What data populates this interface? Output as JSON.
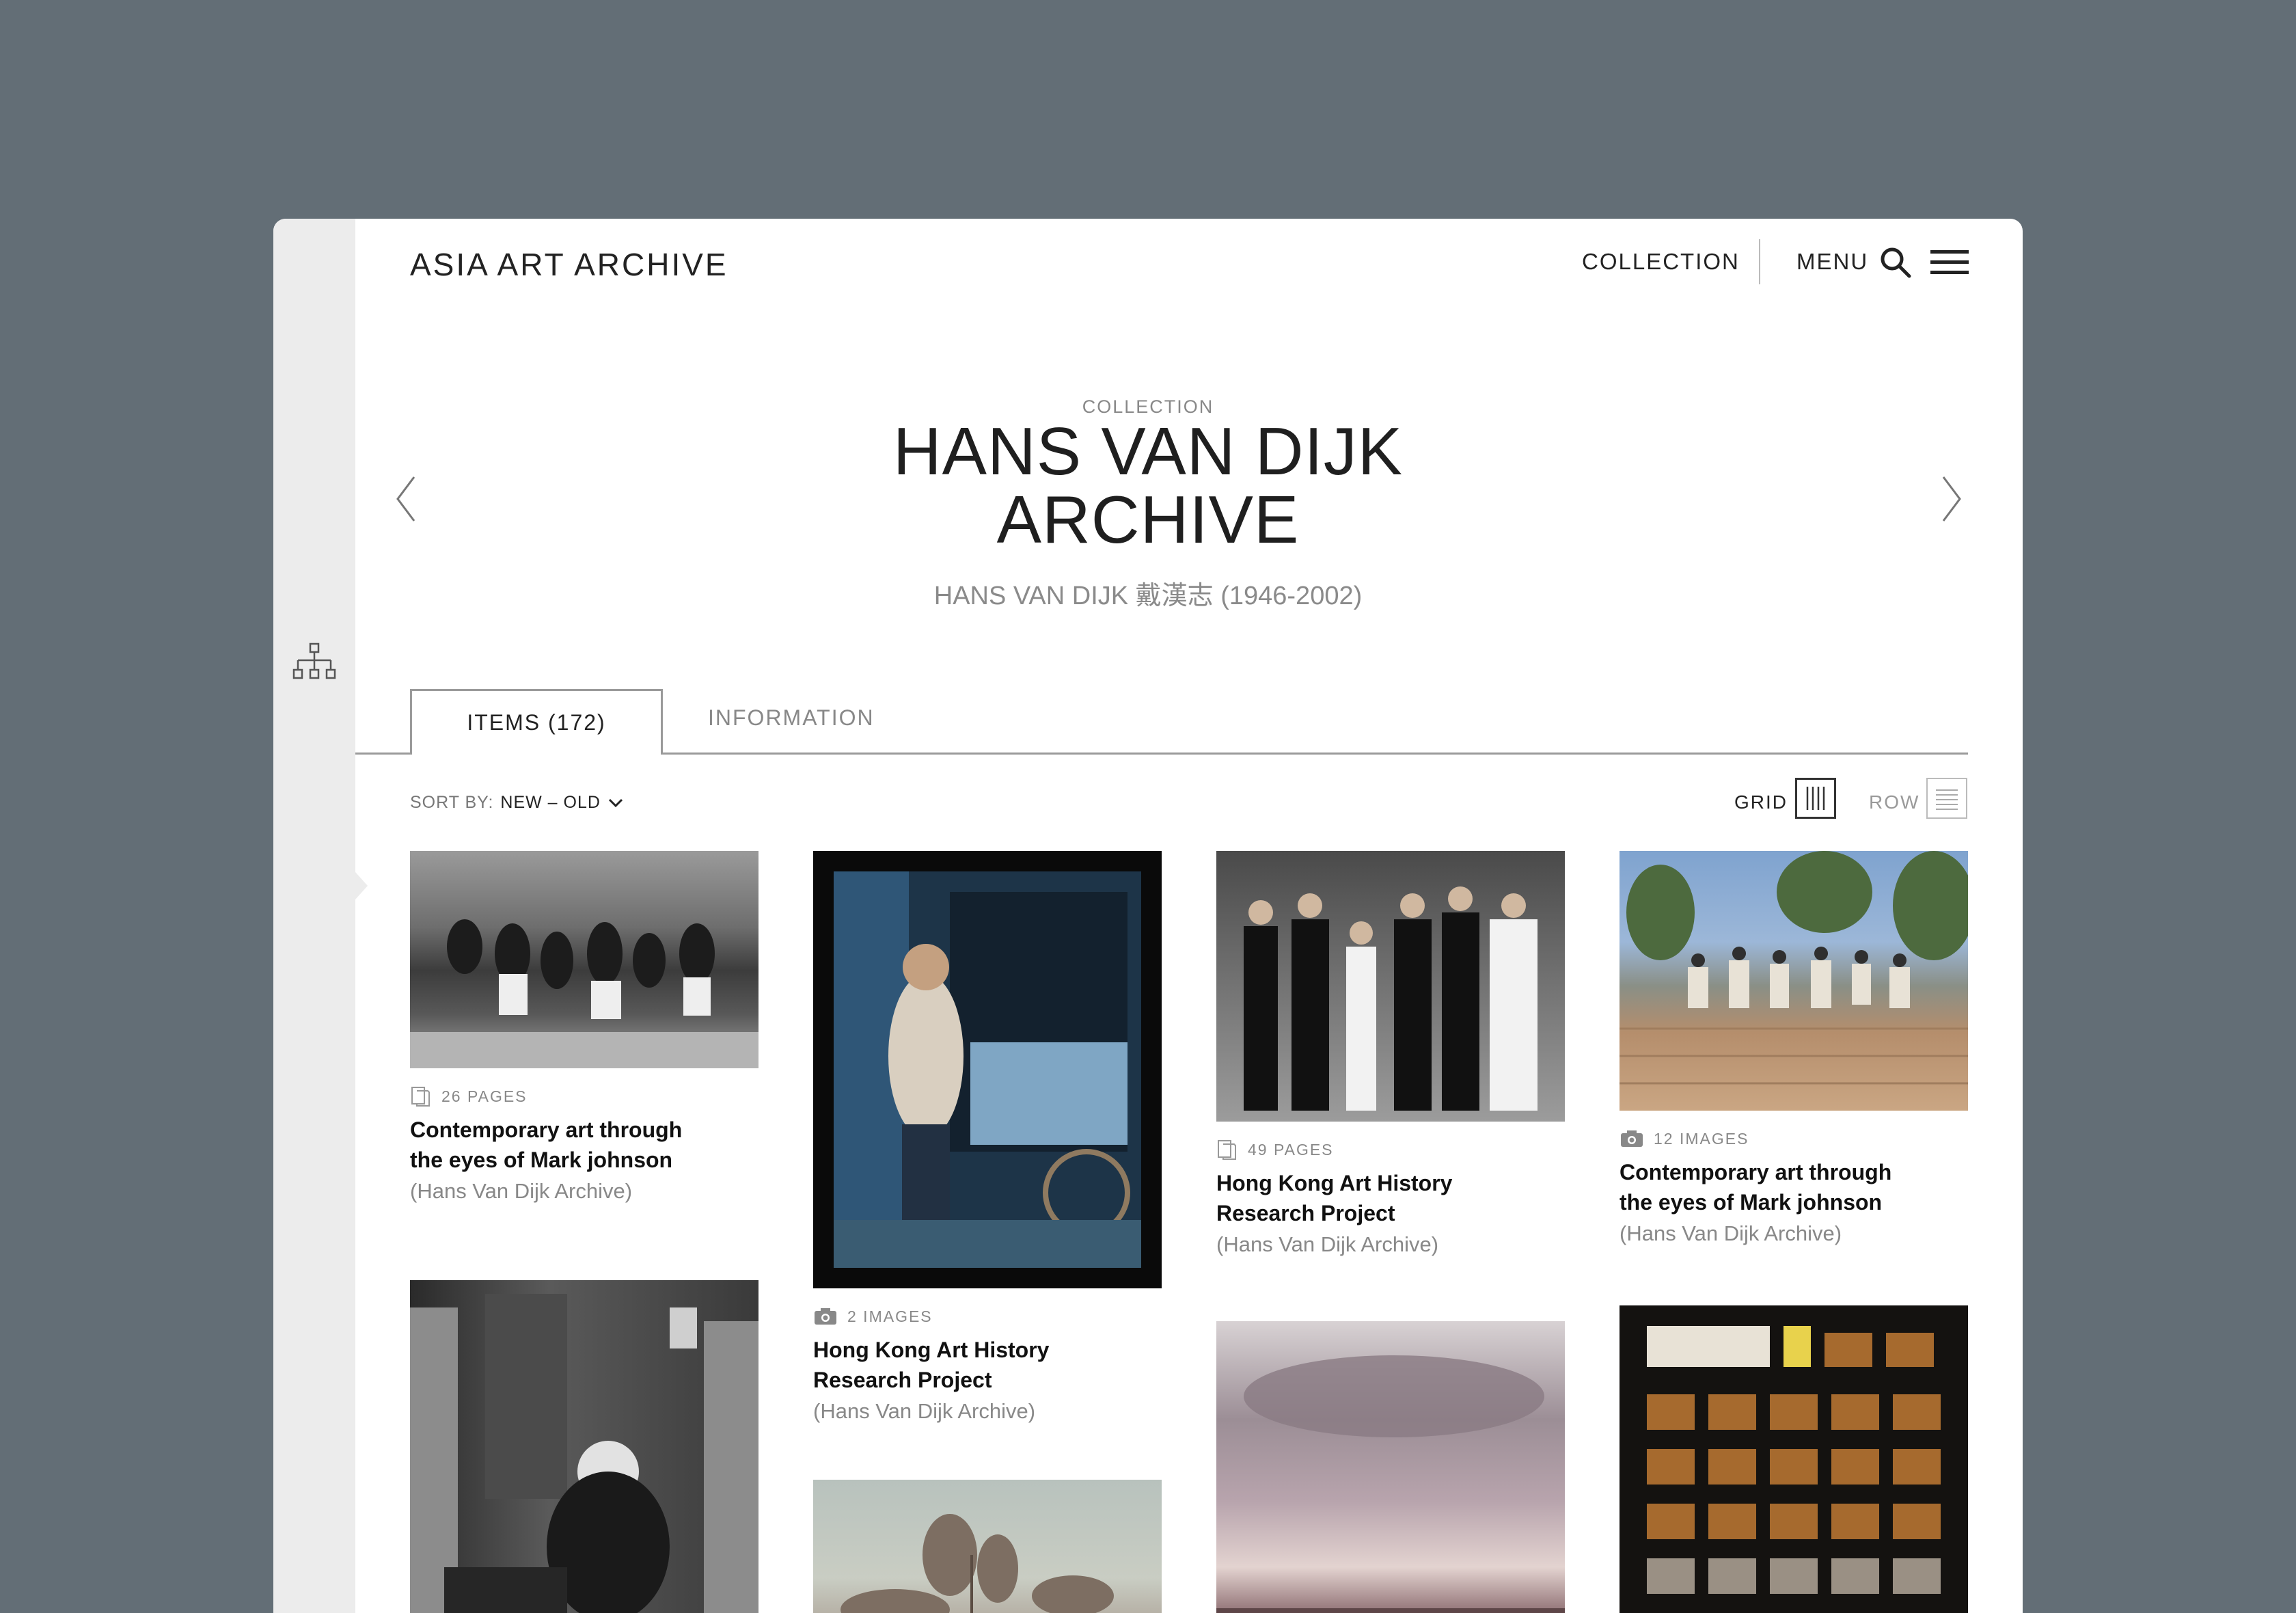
{
  "header": {
    "logo": "ASIA ART ARCHIVE",
    "nav_collection": "COLLECTION",
    "nav_menu": "MENU"
  },
  "hero": {
    "eyebrow": "COLLECTION",
    "title_line1": "HANS VAN DIJK",
    "title_line2": "ARCHIVE",
    "subtitle": "HANS VAN DIJK 戴漢志 (1946-2002)"
  },
  "tabs": [
    {
      "label": "ITEMS (172)",
      "active": true
    },
    {
      "label": "INFORMATION",
      "active": false
    }
  ],
  "toolbar": {
    "sort_prefix": "SORT BY:",
    "sort_value": "NEW – OLD",
    "grid_label": "GRID",
    "row_label": "ROW",
    "view_mode": "grid"
  },
  "items": [
    {
      "meta_icon": "document-icon",
      "meta": "26 PAGES",
      "title": "Contemporary art through the eyes of Mark johnson",
      "source": "(Hans Van Dijk Archive)"
    },
    {
      "meta_icon": "camera-icon",
      "meta": "2 IMAGES",
      "title": "Hong Kong Art History Research Project",
      "source": "(Hans Van Dijk Archive)"
    },
    {
      "meta_icon": "document-icon",
      "meta": "49 PAGES",
      "title": "Hong Kong Art History Research Project",
      "source": "(Hans Van Dijk Archive)"
    },
    {
      "meta_icon": "camera-icon",
      "meta": "12 IMAGES",
      "title": "Contemporary art through the eyes of Mark johnson",
      "source": "(Hans Van Dijk Archive)"
    }
  ],
  "colors": {
    "page_bg": "#636e76",
    "card_bg": "#ffffff",
    "rail_bg": "#ececec",
    "text_primary": "#222222",
    "text_muted": "#888888"
  }
}
